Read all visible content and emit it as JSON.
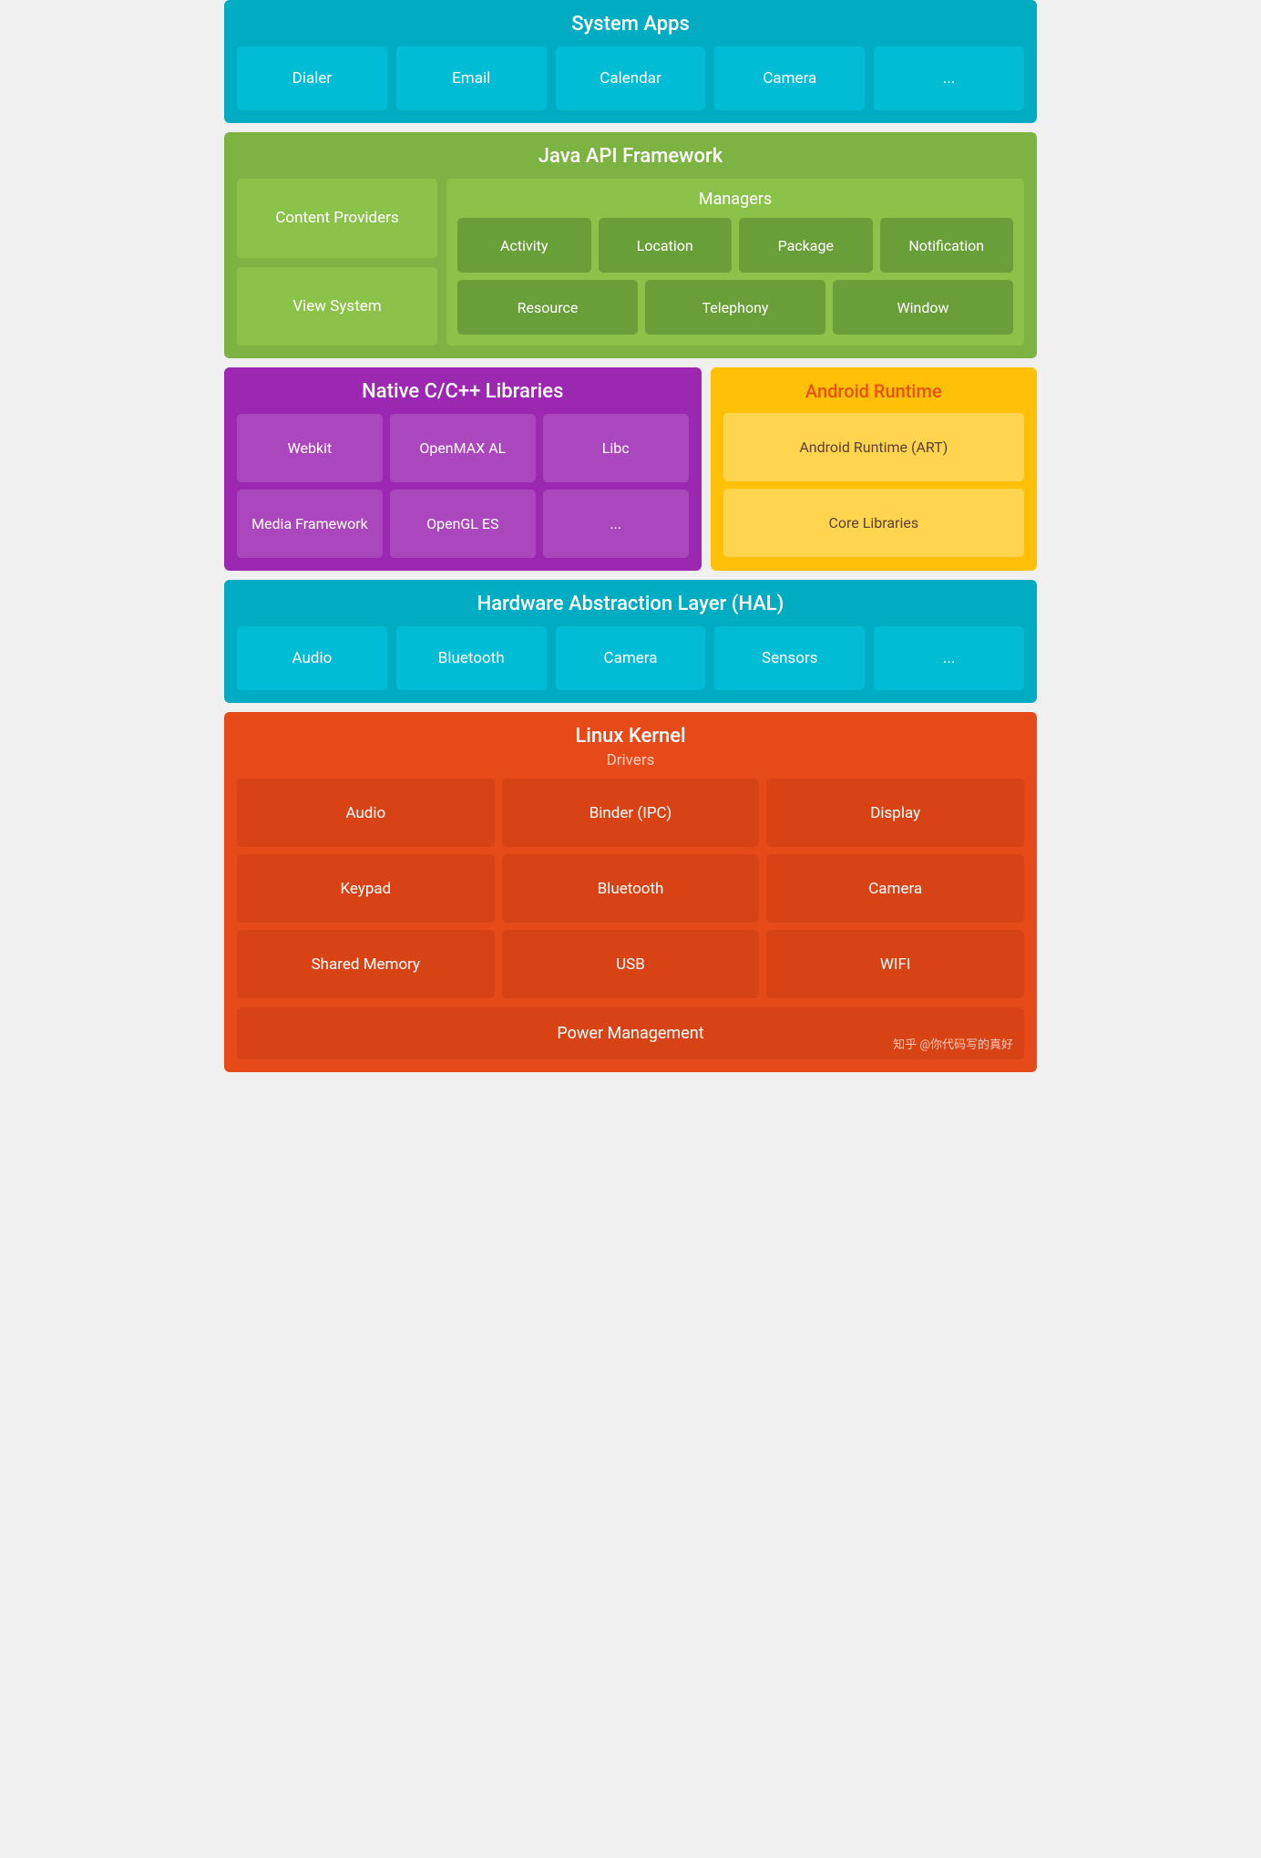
{
  "system_apps": {
    "title": "System Apps",
    "cells": [
      "Dialer",
      "Email",
      "Calendar",
      "Camera",
      "..."
    ]
  },
  "java_api": {
    "title": "Java API Framework",
    "left": [
      "Content Providers",
      "View System"
    ],
    "managers_title": "Managers",
    "managers_row1": [
      "Activity",
      "Location",
      "Package",
      "Notification"
    ],
    "managers_row2": [
      "Resource",
      "Telephony",
      "Window"
    ]
  },
  "native_libs": {
    "title": "Native C/C++ Libraries",
    "row1": [
      "Webkit",
      "OpenMAX AL",
      "Libc"
    ],
    "row2": [
      "Media Framework",
      "OpenGL ES",
      "..."
    ]
  },
  "android_runtime": {
    "title": "Android Runtime",
    "cells": [
      "Android Runtime (ART)",
      "Core Libraries"
    ]
  },
  "hal": {
    "title": "Hardware Abstraction Layer (HAL)",
    "cells": [
      "Audio",
      "Bluetooth",
      "Camera",
      "Sensors",
      "..."
    ]
  },
  "linux_kernel": {
    "title": "Linux Kernel",
    "drivers_title": "Drivers",
    "row1": [
      "Audio",
      "Binder (IPC)",
      "Display"
    ],
    "row2": [
      "Keypad",
      "Bluetooth",
      "Camera"
    ],
    "row3": [
      "Shared Memory",
      "USB",
      "WIFI"
    ],
    "power": "Power Management",
    "watermark": "知乎 @你代码写的真好"
  }
}
